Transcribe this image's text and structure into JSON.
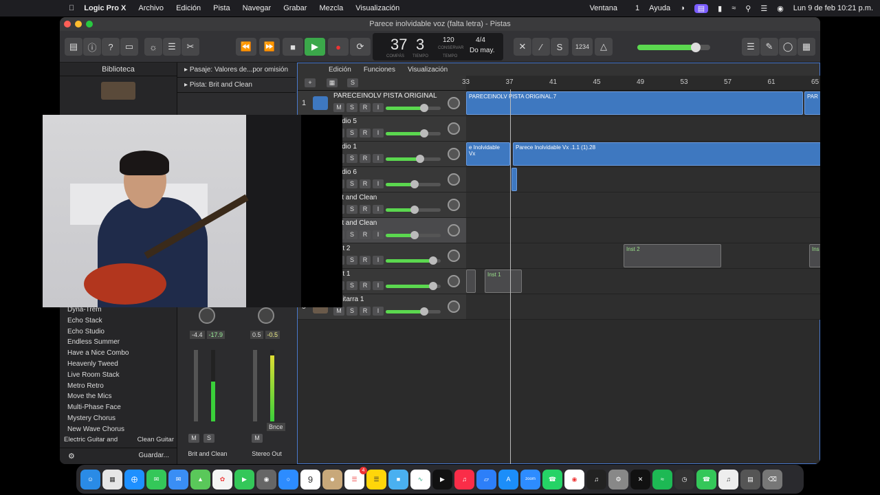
{
  "menubar": {
    "apple": "",
    "app": "Logic Pro X",
    "items": [
      "Archivo",
      "Edición",
      "Pista",
      "Navegar",
      "Grabar",
      "Mezcla",
      "Visualización"
    ],
    "right_items": [
      "Ventana",
      "1",
      "Ayuda"
    ],
    "datetime": "Lun 9 de feb  10:21 p.m."
  },
  "window": {
    "title": "Parece inolvidable voz (falta letra)  - Pistas"
  },
  "lcd": {
    "bar": "37",
    "beat": "3",
    "bar_label": "COMPÁS",
    "beat_label": "TIEMPO",
    "tempo": "120",
    "tempo_mode": "CONSERVAR",
    "tempo_label": "TEMPO",
    "signature": "4/4",
    "key": "Do may.",
    "counter": "1234"
  },
  "library": {
    "title": "Biblioteca",
    "items": [
      "Dyna-Trem",
      "Echo Stack",
      "Echo Studio",
      "Endless Summer",
      "Have a Nice Combo",
      "Heavenly Tweed",
      "Live Room Stack",
      "Metro Retro",
      "Move the Mics",
      "Multi-Phase Face",
      "Mystery Chorus",
      "New Wave Chorus"
    ],
    "breadcrumb_left": "Electric Guitar and",
    "breadcrumb_right": "Clean Guitar",
    "save_label": "Guardar..."
  },
  "inspector": {
    "region_label": "Pasaje:",
    "region_value": "Valores de...por omisión",
    "track_label": "Pista:",
    "track_value": "Brit and Clean",
    "strip1": {
      "gain": "-4.4",
      "peak": "-17.9",
      "name": "Brit and Clean",
      "m": "M",
      "s": "S"
    },
    "strip2": {
      "gain": "0.5",
      "peak": "-0.5",
      "name": "Stereo Out",
      "m": "M",
      "bnce": "Bnce"
    }
  },
  "tracks_area": {
    "menus": [
      "Edición",
      "Funciones",
      "Visualización"
    ],
    "ruler": [
      "33",
      "37",
      "41",
      "45",
      "49",
      "53",
      "57",
      "61",
      "65"
    ],
    "tracks": [
      {
        "num": "1",
        "name": "PARECEINOLV PISTA ORIGINAL",
        "level": 0.7
      },
      {
        "num": "",
        "name": "Audio 5",
        "level": 0.7
      },
      {
        "num": "",
        "name": "Audio 1",
        "level": 0.62
      },
      {
        "num": "",
        "name": "Audio 6",
        "level": 0.52
      },
      {
        "num": "",
        "name": "Brit and Clean",
        "level": 0.53
      },
      {
        "num": "",
        "name": "Brit and Clean",
        "level": 0.53
      },
      {
        "num": "",
        "name": "Inst 2",
        "level": 0.86
      },
      {
        "num": "",
        "name": "Inst 1",
        "level": 0.86
      },
      {
        "num": "9",
        "name": "Guitarra 1",
        "level": 0.7
      }
    ],
    "regions": {
      "original": "PARECEINOLV PISTA ORIGINAL.7",
      "original_tail": "PAR",
      "vx_left": "e Inolvidable Vx",
      "vx_main": "Parece Inolvidable Vx .1.1 (1).28",
      "inst2": "Inst 2",
      "inst2_tail": "Ins",
      "inst1": "Inst 1"
    },
    "labels": {
      "m": "M",
      "s": "S",
      "r": "R",
      "i": "I"
    }
  },
  "dock": {
    "date_num": "9",
    "badge": "4"
  }
}
